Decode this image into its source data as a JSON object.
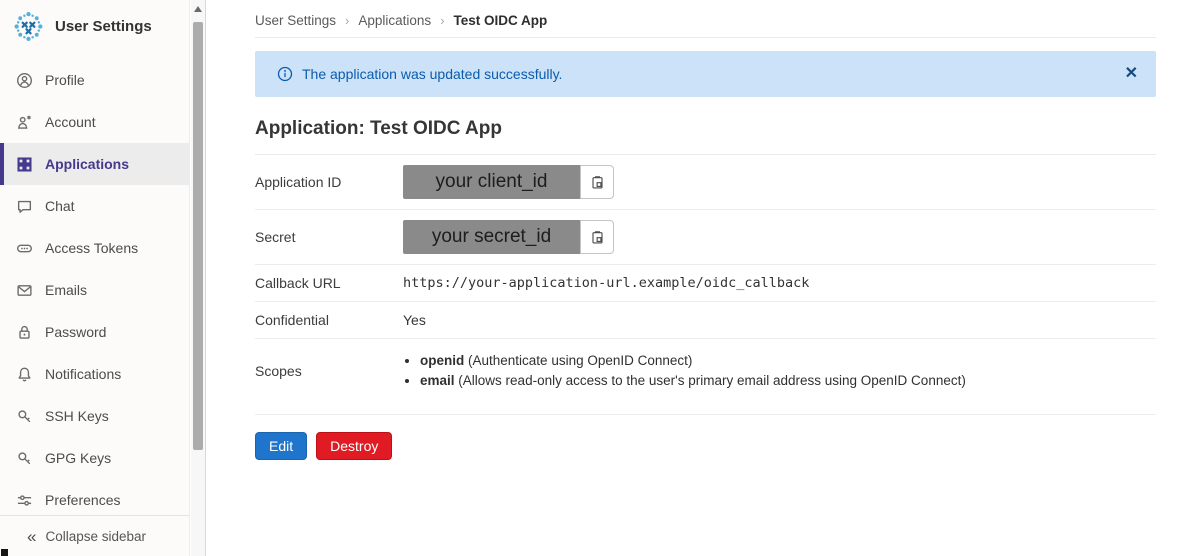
{
  "sidebar": {
    "title": "User Settings",
    "items": [
      {
        "label": "Profile"
      },
      {
        "label": "Account"
      },
      {
        "label": "Applications",
        "active": true
      },
      {
        "label": "Chat"
      },
      {
        "label": "Access Tokens"
      },
      {
        "label": "Emails"
      },
      {
        "label": "Password"
      },
      {
        "label": "Notifications"
      },
      {
        "label": "SSH Keys"
      },
      {
        "label": "GPG Keys"
      },
      {
        "label": "Preferences"
      }
    ],
    "collapse_icon": "«",
    "collapse_label": "Collapse sidebar"
  },
  "breadcrumb": {
    "items": [
      "User Settings",
      "Applications",
      "Test OIDC App"
    ],
    "separator": "›"
  },
  "alert": {
    "message": "The application was updated successfully.",
    "close_label": "✕"
  },
  "page": {
    "title": "Application: Test OIDC App"
  },
  "details": {
    "application_id": {
      "label": "Application ID",
      "value": "your client_id"
    },
    "secret": {
      "label": "Secret",
      "value": "your secret_id"
    },
    "callback": {
      "label": "Callback URL",
      "value": "https://your-application-url.example/oidc_callback"
    },
    "confidential": {
      "label": "Confidential",
      "value": "Yes"
    },
    "scopes": {
      "label": "Scopes",
      "items": [
        {
          "name": "openid",
          "description": "(Authenticate using OpenID Connect)"
        },
        {
          "name": "email",
          "description": "(Allows read-only access to the user's primary email address using OpenID Connect)"
        }
      ]
    }
  },
  "actions": {
    "edit": "Edit",
    "destroy": "Destroy"
  },
  "colors": {
    "active_nav": "#45398e",
    "alert_bg": "#cbe2f9",
    "alert_text": "#0b5cad",
    "edit_button": "#1f75cb",
    "destroy_button": "#e01b24",
    "value_box_bg": "#8a8a8a"
  }
}
